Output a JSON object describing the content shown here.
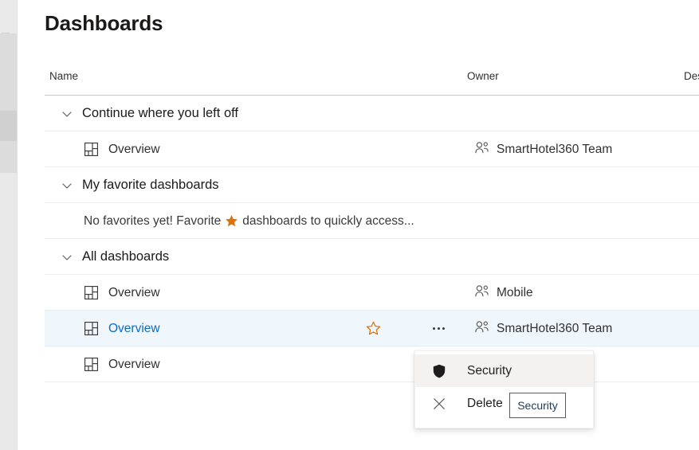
{
  "page": {
    "title": "Dashboards"
  },
  "colors": {
    "accent_link": "#0f6cbd",
    "favorite_star": "#d9730d",
    "selected_row": "#eff6fc",
    "menu_hover": "#f3f2f1",
    "text_primary": "#323130"
  },
  "columns": {
    "name": "Name",
    "owner": "Owner",
    "description": "Des"
  },
  "groups": [
    {
      "label": "Continue where you left off",
      "chevron": "chevron-down-icon",
      "rows": [
        {
          "kind": "dashboard",
          "icon": "dashboard-grid-icon",
          "name": "Overview",
          "owner": "SmartHotel360 Team",
          "owner_icon": "people-icon",
          "selected": false,
          "show_star": false,
          "show_more": false
        }
      ]
    },
    {
      "label": "My favorite dashboards",
      "chevron": "chevron-down-icon",
      "rows": [
        {
          "kind": "empty",
          "text_before": "No favorites yet! Favorite",
          "star_icon": "star-filled-icon",
          "text_after": "dashboards to quickly access..."
        }
      ]
    },
    {
      "label": "All dashboards",
      "chevron": "chevron-down-icon",
      "rows": [
        {
          "kind": "dashboard",
          "icon": "dashboard-grid-icon",
          "name": "Overview",
          "owner": "Mobile",
          "owner_icon": "people-icon",
          "selected": false,
          "show_star": false,
          "show_more": false
        },
        {
          "kind": "dashboard",
          "icon": "dashboard-grid-icon",
          "name": "Overview",
          "owner": "SmartHotel360 Team",
          "owner_icon": "people-icon",
          "selected": true,
          "show_star": true,
          "star_icon": "star-outline-icon",
          "show_more": true,
          "more_icon": "more-ellipsis-icon"
        },
        {
          "kind": "dashboard",
          "icon": "dashboard-grid-icon",
          "name": "Overview",
          "owner": "",
          "owner_icon": "",
          "selected": false,
          "show_star": false,
          "show_more": false
        }
      ]
    }
  ],
  "context_menu": {
    "items": [
      {
        "label": "Security",
        "icon": "shield-icon",
        "hovered": true
      },
      {
        "label": "Delete",
        "icon": "close-x-icon",
        "hovered": false
      }
    ]
  },
  "tooltip": {
    "label": "Security"
  }
}
